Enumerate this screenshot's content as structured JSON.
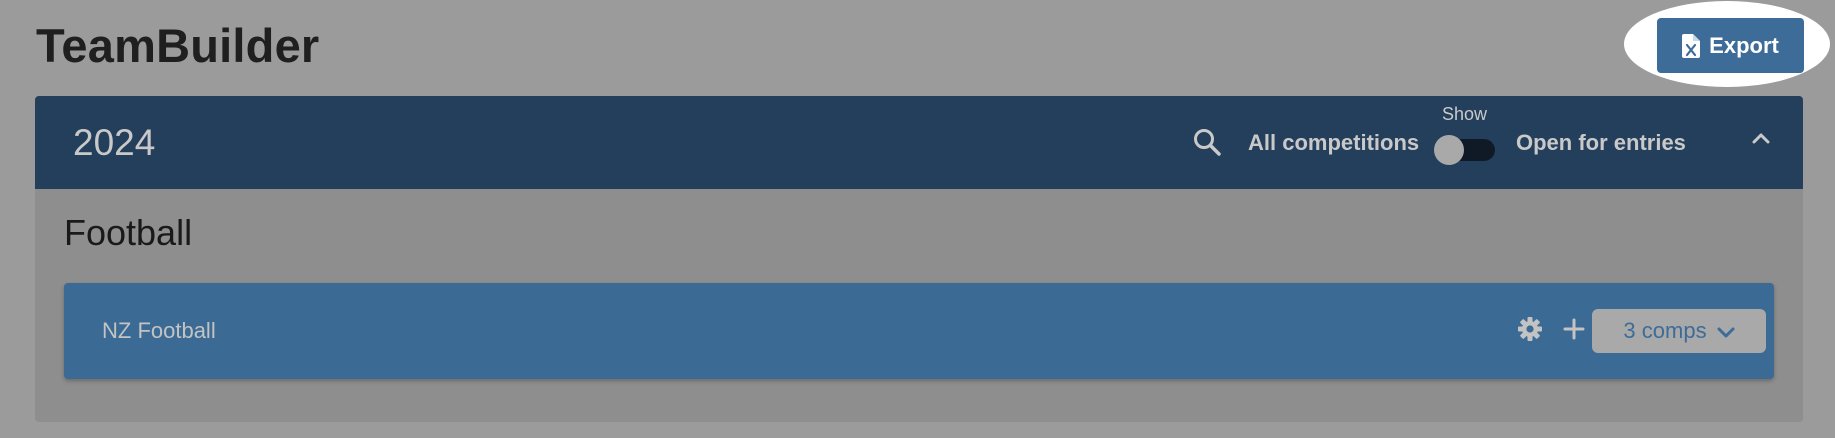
{
  "app": {
    "title": "TeamBuilder"
  },
  "toolbar": {
    "export_label": "Export",
    "export_icon": "excel-file-icon"
  },
  "season": {
    "year": "2024",
    "filters": {
      "search_icon": "search-icon",
      "all_label": "All competitions",
      "toggle_label": "Show",
      "toggle_on": false,
      "open_label": "Open for entries"
    },
    "collapse_icon": "chevron-up-icon"
  },
  "sport": {
    "name": "Football",
    "organisations": [
      {
        "name": "NZ Football",
        "settings_icon": "gear-icon",
        "add_icon": "plus-icon",
        "comps_label": "3 comps",
        "comps_icon": "chevron-down-icon"
      }
    ]
  },
  "colors": {
    "backdrop": "#9b9b9b",
    "header": "#243f5b",
    "card": "#3b6a95",
    "button": "#3d6c98",
    "highlight": "#ffffff"
  }
}
